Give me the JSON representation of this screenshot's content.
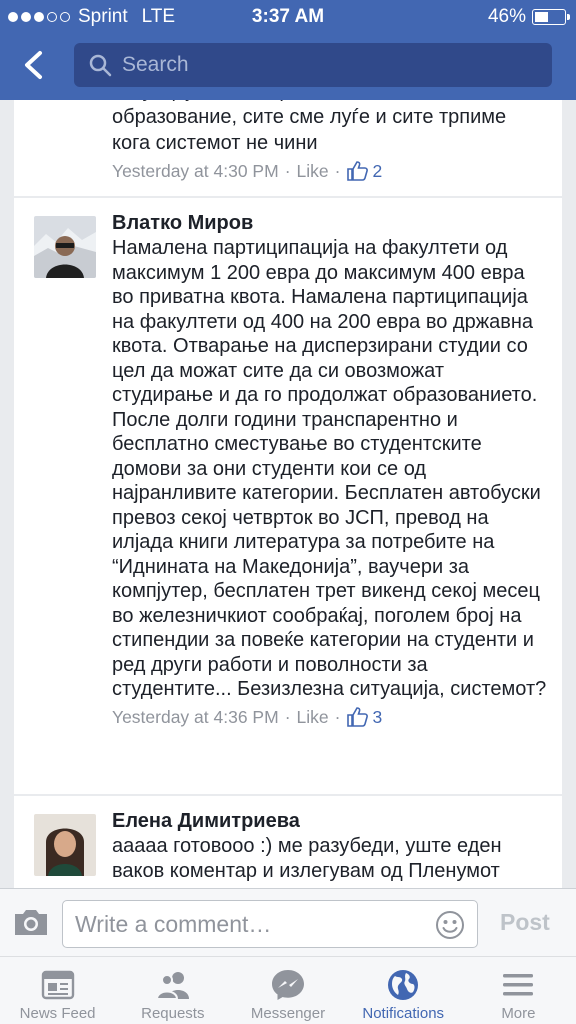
{
  "status_bar": {
    "carrier": "Sprint",
    "network": "LTE",
    "time": "3:37 AM",
    "battery": "46%"
  },
  "header": {
    "search_placeholder": "Search"
  },
  "comments": [
    {
      "author": "",
      "text": "ситуација. Нема врска степенот на образование, сите сме луѓе и сите трпиме кога системот не чини",
      "time": "Yesterday at 4:30 PM",
      "like_label": "Like",
      "likes": "2"
    },
    {
      "author": "Влатко Миров",
      "text": "Намалена партиципација на факултети од максимум 1 200 евра до максимум 400 евра во приватна квота. Намалена партиципација на факултети од 400 на 200 евра во државна квота. Отварање на дисперзирани студии со цел да можат сите да си овозможат студирање и да го продолжат образованието. После долги години транспарентно и бесплатно сместување во студентските домови за они студенти кои се од најранливите категории. Бесплатен автобуски превоз секој четврток во ЈСП, превод на илјада книги литература за потребите на “Иднината на Македонија”, ваучери за компјутер, бесплатен трет викенд секој месец во железничкиот сообраќај, поголем број на стипендии за повеќе категории на студенти и ред други работи и поволности за студентите... Безизлезна ситуација, системот?",
      "time": "Yesterday at 4:36 PM",
      "like_label": "Like",
      "likes": "3"
    },
    {
      "author": "Елена Димитриева",
      "text": "ааааа готовооо :) ме разубеди, уште еден ваков коментар и излегувам од Пленумот",
      "time": "",
      "like_label": "",
      "likes": ""
    }
  ],
  "composer": {
    "placeholder": "Write a comment…",
    "post_label": "Post"
  },
  "tabs": [
    {
      "label": "News Feed",
      "icon": "news-feed-icon"
    },
    {
      "label": "Requests",
      "icon": "friend-requests-icon"
    },
    {
      "label": "Messenger",
      "icon": "messenger-icon"
    },
    {
      "label": "Notifications",
      "icon": "globe-icon",
      "active": true
    },
    {
      "label": "More",
      "icon": "menu-icon"
    }
  ],
  "colors": {
    "brand": "#4267b2",
    "background": "#e9ebee",
    "meta": "#90949c"
  }
}
